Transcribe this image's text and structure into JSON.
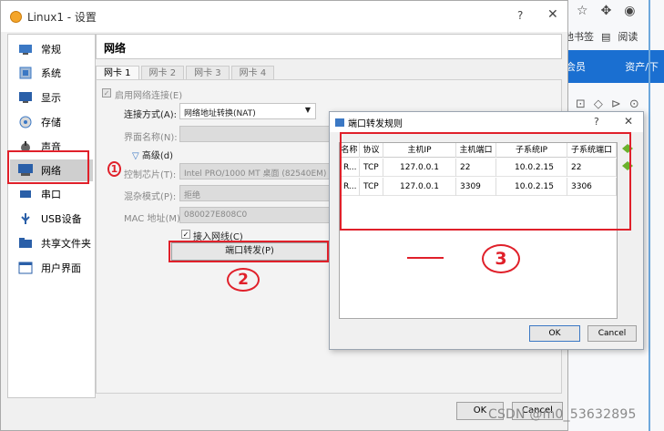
{
  "window": {
    "title": "Linux1 - 设置",
    "help_label": "?",
    "close_label": "✕"
  },
  "nav": {
    "items": [
      {
        "label": "常规",
        "icon": "general-icon"
      },
      {
        "label": "系统",
        "icon": "system-icon"
      },
      {
        "label": "显示",
        "icon": "display-icon"
      },
      {
        "label": "存储",
        "icon": "storage-icon"
      },
      {
        "label": "声音",
        "icon": "audio-icon"
      },
      {
        "label": "网络",
        "icon": "network-icon",
        "selected": true
      },
      {
        "label": "串口",
        "icon": "serial-port-icon"
      },
      {
        "label": "USB设备",
        "icon": "usb-icon"
      },
      {
        "label": "共享文件夹",
        "icon": "shared-folder-icon"
      },
      {
        "label": "用户界面",
        "icon": "user-interface-icon"
      }
    ]
  },
  "section": {
    "title": "网络"
  },
  "tabs": [
    "网卡 1",
    "网卡 2",
    "网卡 3",
    "网卡 4"
  ],
  "adapter": {
    "enable_label": "启用网络连接(E)",
    "attached_label": "连接方式(A):",
    "attached_value": "网络地址转换(NAT)",
    "name_label": "界面名称(N):",
    "advanced_label": "高级(d)",
    "chip_label": "控制芯片(T):",
    "chip_value": "Intel PRO/1000 MT 桌面 (82540EM)",
    "promisc_label": "混杂模式(P):",
    "promisc_value": "拒绝",
    "mac_label": "MAC 地址(M):",
    "mac_value": "080027E808C0",
    "cable_label": "接入网线(C)",
    "port_forward_label": "端口转发(P)"
  },
  "buttons": {
    "ok": "OK",
    "cancel": "Cancel"
  },
  "dialog": {
    "title": "端口转发规则",
    "help_label": "?",
    "close_label": "✕",
    "columns": [
      "名称",
      "协议",
      "主机IP",
      "主机端口",
      "子系统IP",
      "子系统端口"
    ],
    "rows": [
      [
        "R...",
        "TCP",
        "127.0.0.1",
        "22",
        "10.0.2.15",
        "22"
      ],
      [
        "R...",
        "TCP",
        "127.0.0.1",
        "3309",
        "10.0.2.15",
        "3306"
      ]
    ],
    "ok_label": "OK",
    "cancel_label": "Cancel"
  },
  "browser": {
    "bookmark_text": "他书签",
    "reading_text": "阅读",
    "member_text": "会员",
    "tab_text": "资产/下"
  },
  "annotations": {
    "step1": "1",
    "step2": "2",
    "step3": "3"
  },
  "watermark": "CSDN @m0_53632895",
  "colors": {
    "annotation": "#e0202a",
    "browser_accent": "#1a6fd1"
  }
}
